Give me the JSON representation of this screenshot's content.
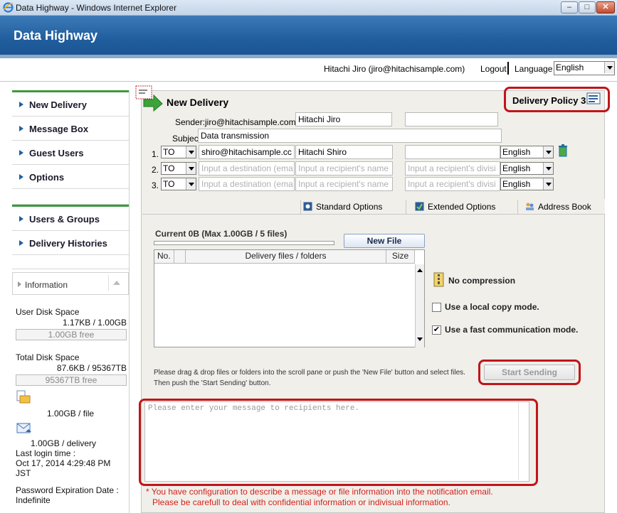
{
  "window": {
    "title": "Data Highway - Windows Internet Explorer",
    "controls": [
      "–",
      "□",
      "✕"
    ]
  },
  "app": {
    "name": "Data Highway"
  },
  "user_bar": {
    "user": "Hitachi Jiro (jiro@hitachisample.com)",
    "logout": "Logout",
    "language_label": "Language",
    "language_value": "English"
  },
  "sidebar": {
    "items": [
      {
        "label": "New Delivery"
      },
      {
        "label": "Message Box"
      },
      {
        "label": "Guest Users"
      },
      {
        "label": "Options"
      },
      {
        "label": "Users & Groups"
      },
      {
        "label": "Delivery Histories"
      }
    ],
    "information": {
      "heading": "Information",
      "user_disk_label": "User Disk Space",
      "user_disk_value": "1.17KB / 1.00GB",
      "user_disk_free": "1.00GB free",
      "total_disk_label": "Total Disk Space",
      "total_disk_value": "87.6KB / 95367TB",
      "total_disk_free": "95367TB free",
      "per_file": "1.00GB / file",
      "per_delivery": "1.00GB / delivery",
      "last_login_label": "Last login time :",
      "last_login_value_1": "Oct 17, 2014 4:29:48 PM",
      "last_login_value_2": "JST",
      "password_label_1": "Password Expiration Date :",
      "password_value": "Indefinite"
    }
  },
  "delivery": {
    "title": "New Delivery",
    "policy": "Delivery Policy 3",
    "sender_label": "Sender:",
    "sender_email": "jiro@hitachisample.com",
    "sender_name": "Hitachi Jiro",
    "sender_division": "",
    "subject_label": "Subject:",
    "subject_value": "Data transmission",
    "recipients": [
      {
        "num": "1.",
        "type": "TO",
        "address": "shiro@hitachisample.cc",
        "name": "Hitachi Shiro",
        "division": "",
        "language": "English"
      },
      {
        "num": "2.",
        "type": "TO",
        "address": "Input a destination (ema",
        "name": "Input a recipient's name",
        "division": "Input a recipient's divisi",
        "language": "English"
      },
      {
        "num": "3.",
        "type": "TO",
        "address": "Input a destination (ema",
        "name": "Input a recipient's name",
        "division": "Input a recipient's divisi",
        "language": "English"
      }
    ],
    "tabs": [
      {
        "label": "Standard Options"
      },
      {
        "label": "Extended Options"
      },
      {
        "label": "Address Book"
      }
    ],
    "current": "Current 0B (Max 1.00GB / 5 files)",
    "new_file": "New File",
    "file_columns": [
      "No.",
      "Delivery files / folders",
      "Size"
    ],
    "no_compression": "No compression",
    "local_copy": "Use a local copy mode.",
    "fast_comm": "Use a fast communication mode.",
    "local_copy_checked": false,
    "fast_comm_checked": true,
    "help_line_1": "Please drag & drop files or folders into the scroll pane or push the 'New File' button and select files.",
    "help_line_2": "Then push the 'Start Sending' button.",
    "start_sending": "Start Sending",
    "message_placeholder": "Please enter your message to recipients here.",
    "warning_line_1": "* You have configuration to describe a message or file information into the notification email.",
    "warning_line_2": "Please be carefull to deal with confidential information or indivisual information."
  },
  "colors": {
    "banner": "#215e9d",
    "highlight": "#c0151a",
    "warning": "#d8201a",
    "nav_green": "#3c9a3c"
  }
}
